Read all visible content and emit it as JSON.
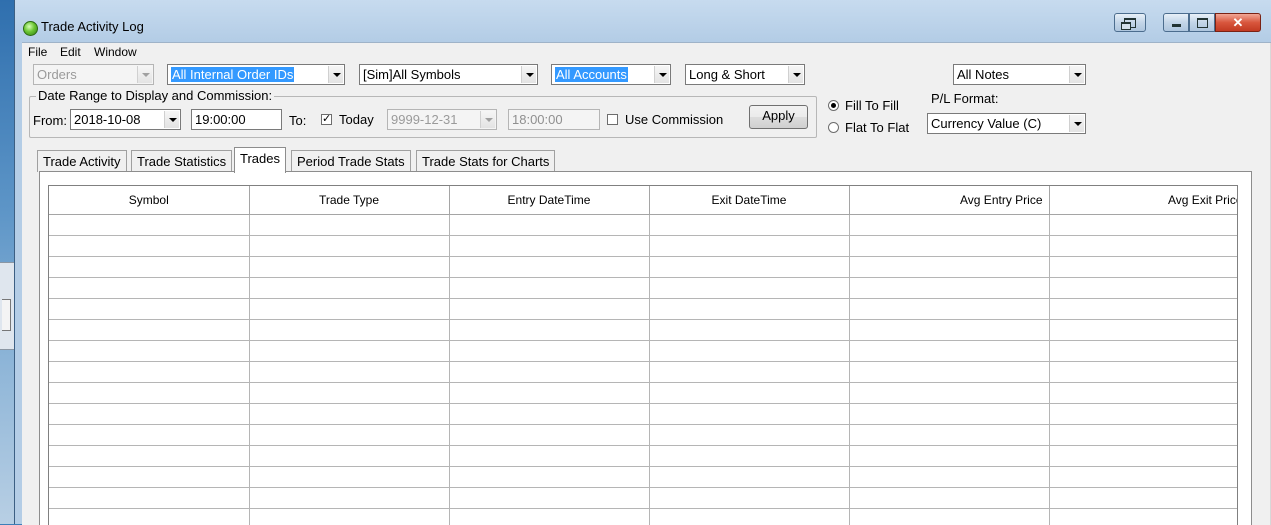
{
  "window": {
    "title": "Trade Activity Log"
  },
  "menu": [
    "File",
    "Edit",
    "Window"
  ],
  "filters": {
    "orders": "Orders",
    "order_ids": "All Internal Order IDs",
    "symbols": "[Sim]All Symbols",
    "accounts": "All Accounts",
    "direction": "Long & Short",
    "notes": "All Notes"
  },
  "date_range": {
    "legend": "Date Range to Display and Commission:",
    "from_label": "From:",
    "from_date": "2018-10-08",
    "from_time": "19:00:00",
    "to_label": "To:",
    "today_label": "Today",
    "today_checked": true,
    "to_date": "9999-12-31",
    "to_time": "18:00:00",
    "commission_label": "Use Commission",
    "commission_checked": false,
    "apply_label": "Apply"
  },
  "fill_mode": {
    "options": [
      "Fill To Fill",
      "Flat To Flat"
    ],
    "selected": "Fill To Fill"
  },
  "pl_format": {
    "label": "P/L Format:",
    "value": "Currency Value (C)"
  },
  "tabs": [
    {
      "label": "Trade Activity",
      "active": false
    },
    {
      "label": "Trade Statistics",
      "active": false
    },
    {
      "label": "Trades",
      "active": true
    },
    {
      "label": "Period Trade Stats",
      "active": false
    },
    {
      "label": "Trade Stats for Charts",
      "active": false
    }
  ],
  "table": {
    "columns": [
      "Symbol",
      "Trade Type",
      "Entry DateTime",
      "Exit DateTime",
      "Avg Entry Price",
      "Avg Exit Price"
    ],
    "rows": []
  },
  "colors": {
    "selection": "#3399ff",
    "title_bar": "#b4cde6",
    "close_button": "#c23a22"
  }
}
